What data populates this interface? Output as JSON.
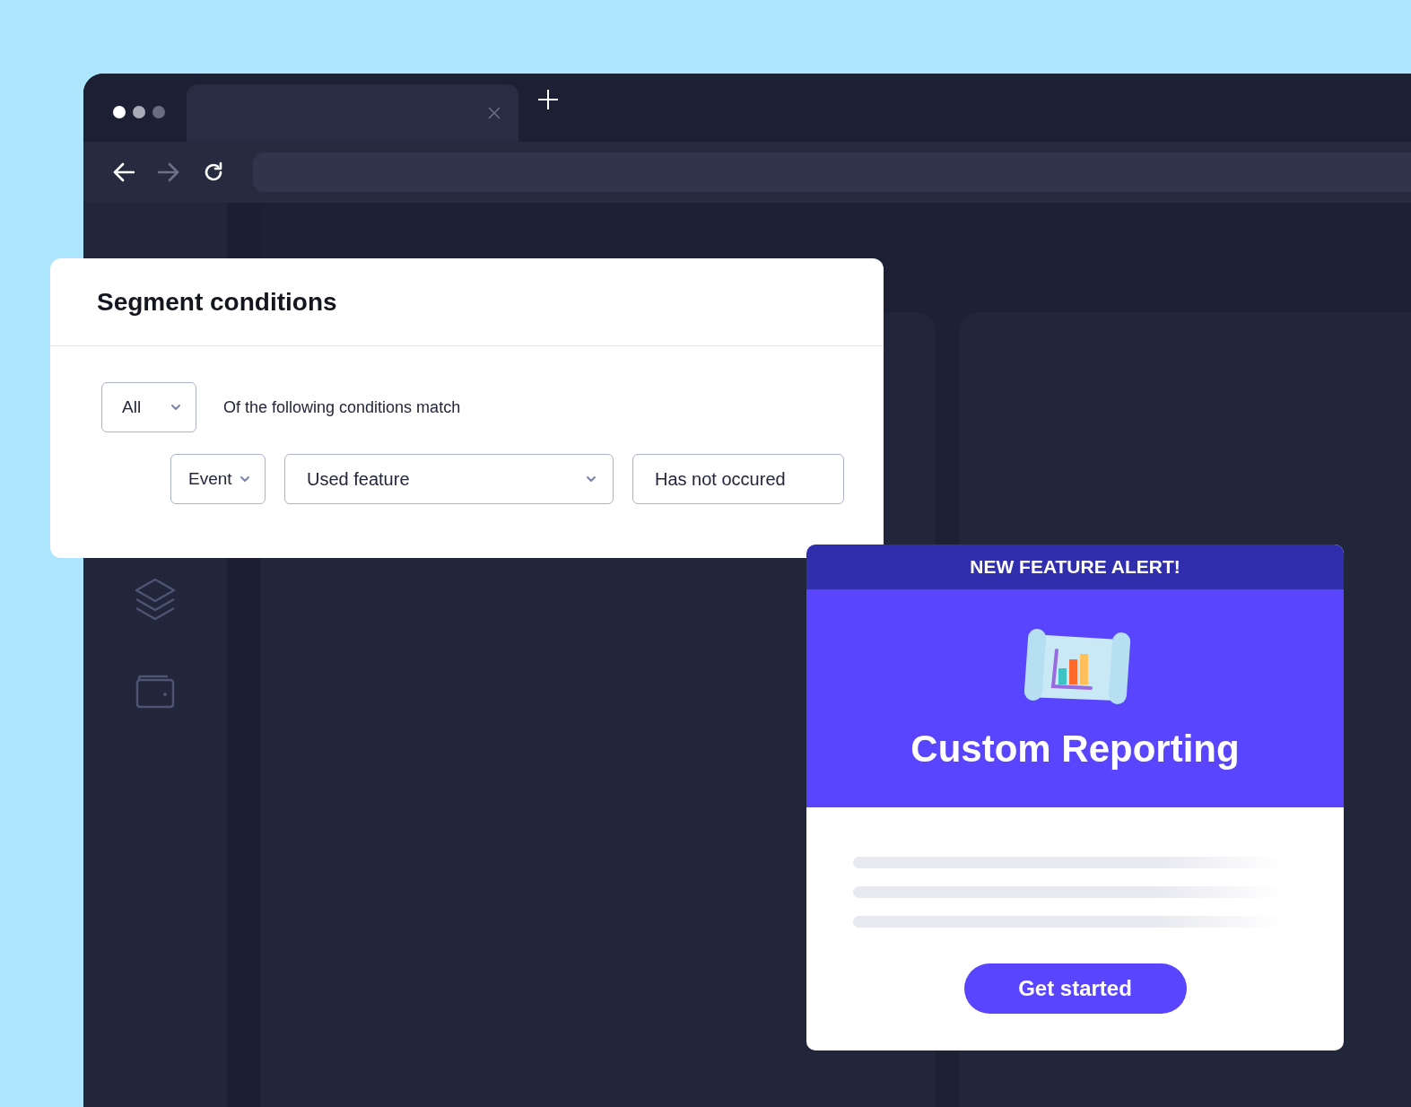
{
  "segment_conditions": {
    "title": "Segment conditions",
    "match_select": "All",
    "match_text": "Of the following conditions match",
    "condition": {
      "type_select": "Event",
      "property_select": "Used feature",
      "operator_field": "Has not occured"
    }
  },
  "feature_alert": {
    "banner": "NEW FEATURE ALERT!",
    "title": "Custom Reporting",
    "button": "Get started"
  }
}
